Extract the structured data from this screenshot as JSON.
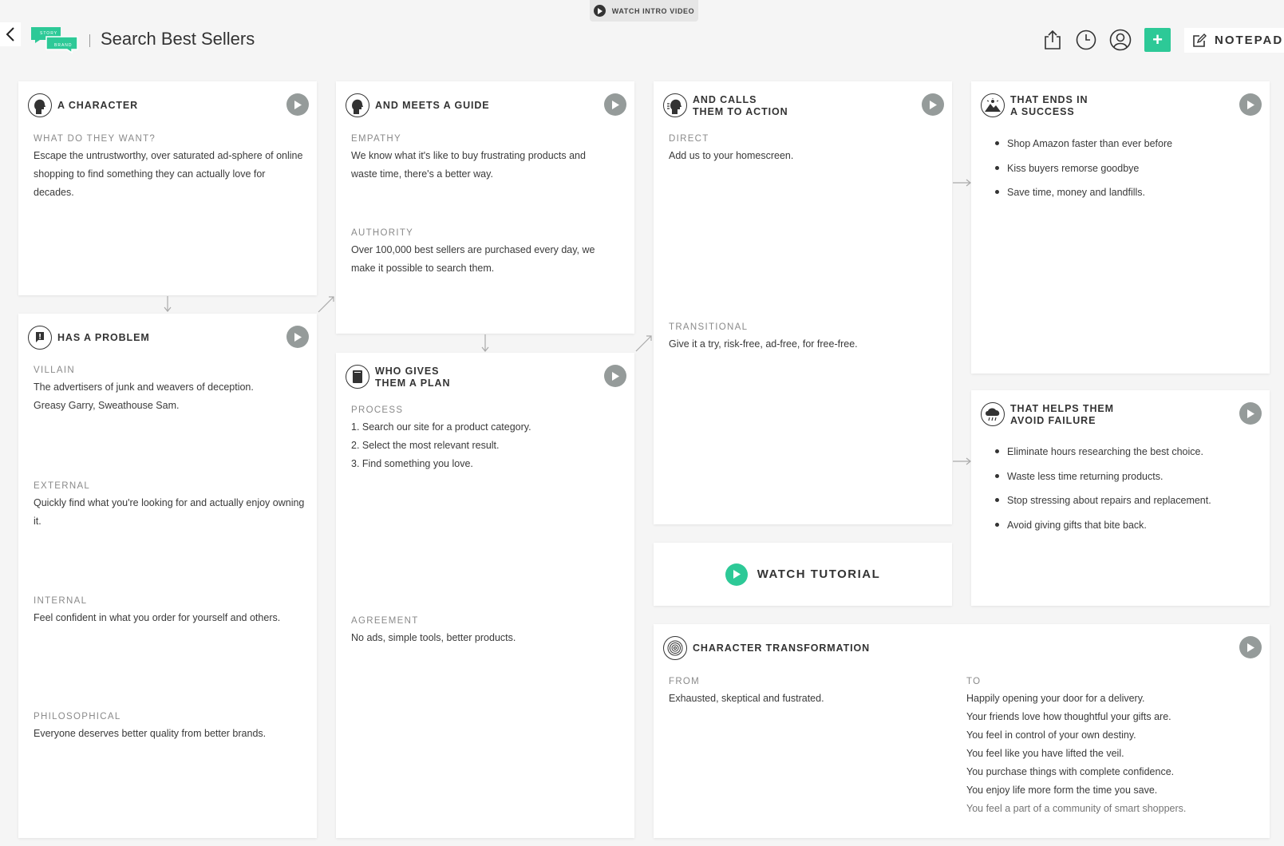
{
  "header": {
    "intro_video_label": "WATCH INTRO VIDEO",
    "logo_top": "STORY",
    "logo_bottom": "BRAND",
    "page_title": "Search Best Sellers",
    "notepad_label": "NOTEPAD",
    "add_label": "+"
  },
  "colors": {
    "accent": "#2dc997",
    "play": "#959b9a",
    "background": "#f5f5f5"
  },
  "character": {
    "title": "A CHARACTER",
    "want_label": "WHAT DO THEY WANT?",
    "want_text": "Escape the untrustworthy, over saturated ad-sphere of online shopping to find something they can actually love for decades."
  },
  "problem": {
    "title": "HAS A PROBLEM",
    "villain_label": "VILLAIN",
    "villain_text": "The advertisers of junk and weavers of deception. Greasy Garry, Sweathouse Sam.",
    "external_label": "EXTERNAL",
    "external_text": "Quickly find what you're looking for and actually enjoy owning it.",
    "internal_label": "INTERNAL",
    "internal_text": "Feel confident in what you order for yourself and others.",
    "philosophical_label": "PHILOSOPHICAL",
    "philosophical_text": "Everyone deserves better quality from better brands."
  },
  "guide": {
    "title": "AND MEETS A GUIDE",
    "empathy_label": "EMPATHY",
    "empathy_text": "We know what it's like to buy frustrating products and waste time, there's a better way.",
    "authority_label": "AUTHORITY",
    "authority_text": "Over 100,000 best sellers are purchased every day, we make it possible to search them."
  },
  "plan": {
    "title_line1": "WHO GIVES",
    "title_line2": "THEM A PLAN",
    "process_label": "PROCESS",
    "steps": [
      "1. Search our site for a product category.",
      "2. Select the most relevant result.",
      "3. Find something you love."
    ],
    "agreement_label": "AGREEMENT",
    "agreement_text": "No ads, simple tools, better products."
  },
  "action": {
    "title_line1": "AND CALLS",
    "title_line2": "THEM TO ACTION",
    "direct_label": "DIRECT",
    "direct_text": "Add us to your homescreen.",
    "transitional_label": "TRANSITIONAL",
    "transitional_text": "Give it a try, risk-free, ad-free, for free-free."
  },
  "tutorial": {
    "label": "WATCH TUTORIAL"
  },
  "success": {
    "title_line1": "THAT ENDS IN",
    "title_line2": "A SUCCESS",
    "items": [
      "Shop Amazon faster than ever before",
      "Kiss buyers remorse goodbye",
      "Save time, money and landfills."
    ]
  },
  "failure": {
    "title_line1": "THAT HELPS THEM",
    "title_line2": "AVOID FAILURE",
    "items": [
      "Eliminate hours researching the best choice.",
      "Waste less time returning products.",
      "Stop stressing about repairs and replacement.",
      "Avoid giving gifts that bite back."
    ]
  },
  "transformation": {
    "title": "CHARACTER TRANSFORMATION",
    "from_label": "FROM",
    "from_text": "Exhausted, skeptical and fustrated.",
    "to_label": "TO",
    "to_items": [
      "Happily opening your door for a delivery.",
      "Your friends love how thoughtful your gifts are.",
      "You feel in control of your own destiny.",
      "You feel like you have lifted the veil.",
      "You purchase things with complete confidence.",
      "You enjoy life more form the time you save.",
      "You feel a part of a community of smart shoppers."
    ]
  }
}
